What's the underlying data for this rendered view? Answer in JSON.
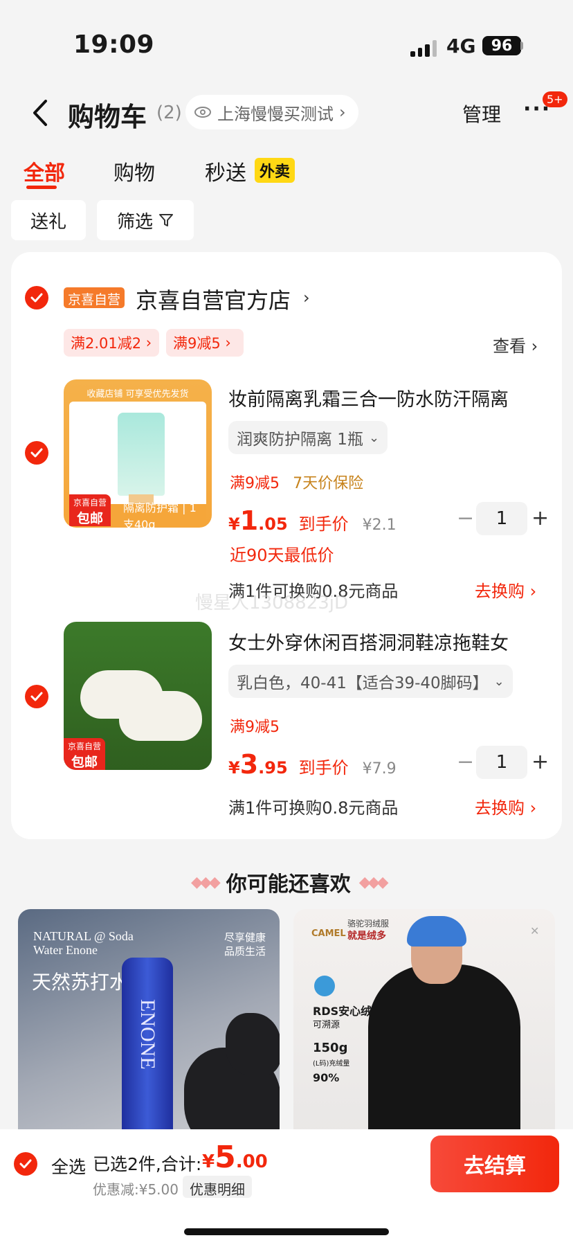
{
  "status": {
    "time": "19:09",
    "network": "4G",
    "battery": "96"
  },
  "nav": {
    "title": "购物车",
    "count": "(2)",
    "location": "上海慢慢买测试",
    "manage": "管理",
    "more_badge": "5+"
  },
  "tabs": [
    {
      "label": "全部"
    },
    {
      "label": "购物"
    },
    {
      "label": "秒送",
      "badge": "外卖"
    }
  ],
  "filters": {
    "gift": "送礼",
    "filter": "筛选"
  },
  "store": {
    "tag": "京喜自营",
    "name": "京喜自营官方店",
    "promos": [
      "满2.01减2",
      "满9减5"
    ],
    "view": "查看"
  },
  "products": [
    {
      "title": "妆前隔离乳霜三合一防水防汗隔离",
      "sku": "润爽防护隔离 1瓶",
      "tags": [
        "满9减5",
        "7天价保险"
      ],
      "price_int": "1",
      "price_dec": ".05",
      "price_label": "到手价",
      "orig_price": "¥2.1",
      "low_price_note": "近90天最低价",
      "qty": "1",
      "swap_text": "满1件可换购0.8元商品",
      "swap_link": "去换购",
      "img_top": "收藏店铺 可享受优先发货",
      "img_bottom": "隔离防护霜 | 1支40g",
      "img_tag1": "京喜自营",
      "img_tag2": "包邮"
    },
    {
      "title": "女士外穿休闲百搭洞洞鞋凉拖鞋女",
      "sku": "乳白色，40-41【适合39-40脚码】",
      "tags": [
        "满9减5"
      ],
      "price_int": "3",
      "price_dec": ".95",
      "price_label": "到手价",
      "orig_price": "¥7.9",
      "qty": "1",
      "swap_text": "满1件可换购0.8元商品",
      "swap_link": "去换购",
      "img_tag1": "京喜自营",
      "img_tag2": "包邮"
    }
  ],
  "watermark": "慢星人1308823jD",
  "recommend": {
    "title": "你可能还喜欢",
    "item1": {
      "brand": "NATURAL @ Soda Water Enone",
      "name": "天然苏打水",
      "slogan1": "尽享健康",
      "slogan2": "品质生活",
      "bottle": "ENONE"
    },
    "item2": {
      "brand": "CAMEL",
      "brand_cn": "骆驼羽绒服",
      "tagline": "就是绒多",
      "rds": "RDS安心绒",
      "trace": "可溯源",
      "fill": "150g",
      "fill_note": "(L码)充绒量",
      "down": "90%"
    }
  },
  "bottom": {
    "select_all": "全选",
    "selected": "已选2件,合计:",
    "total_yen": "¥",
    "total_int": "5",
    "total_dec": ".00",
    "discount": "优惠减:¥5.00",
    "discount_detail": "优惠明细",
    "checkout": "去结算"
  },
  "colors": {
    "accent": "#f2270c",
    "store_tag": "#f57a2a",
    "badge_yellow": "#ffd814"
  }
}
